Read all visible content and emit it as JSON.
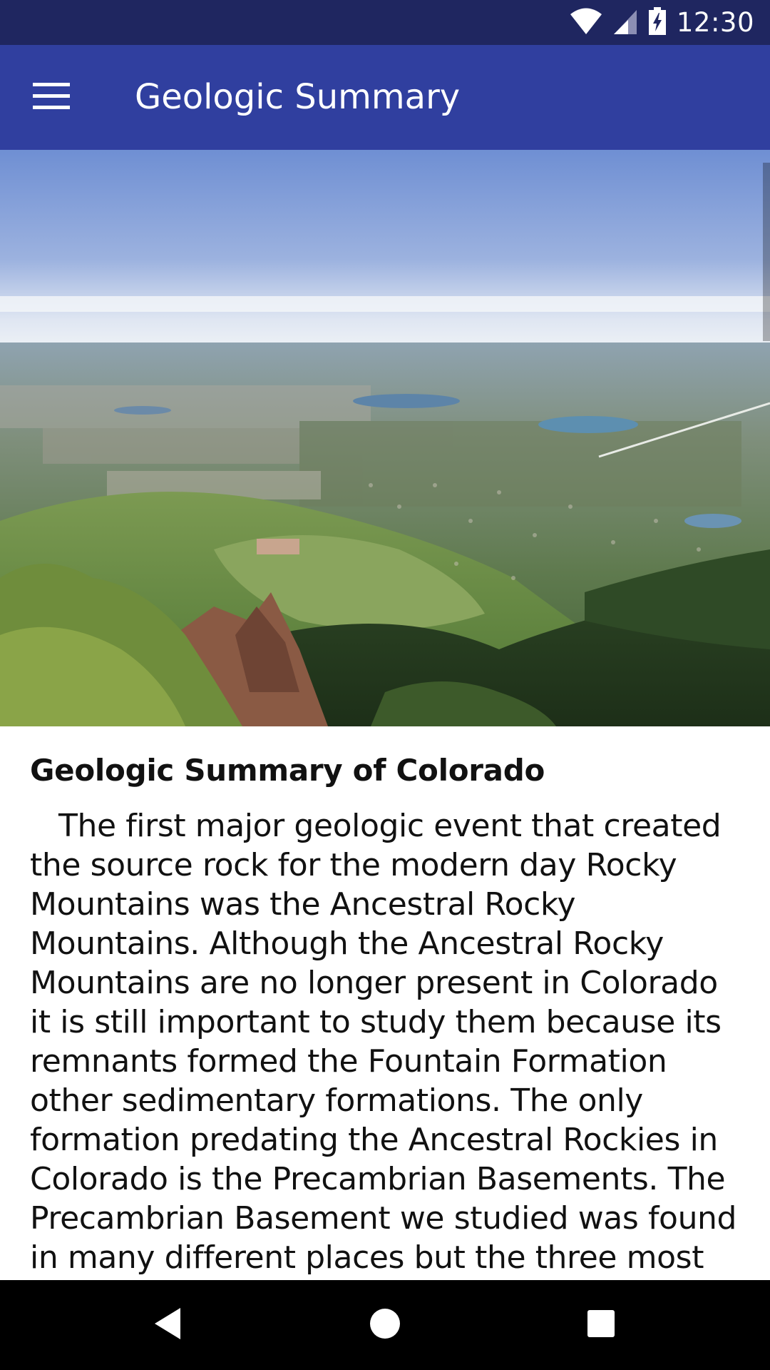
{
  "status_bar": {
    "time": "12:30",
    "icons": [
      "wifi-icon",
      "cell-signal-icon",
      "battery-charging-icon"
    ]
  },
  "app_bar": {
    "title": "Geologic Summary",
    "menu_icon": "hamburger-menu-icon",
    "color": "#303f9f"
  },
  "hero_image": {
    "subject": "aerial landscape photo"
  },
  "content": {
    "heading": "Geologic Summary of Colorado",
    "body": "The first major geologic event that created the source rock for the modern day Rocky Mountains was the Ancestral Rocky Mountains. Although the Ancestral Rocky Mountains are no longer present in Colorado it is still important to study them because its remnants formed the Fountain Formation other sedimentary formations. The only formation predating the Ancestral Rockies in Colorado is the Precambrian Basements. The Precambrian Basement we studied was found in many different places but the three most prominent"
  },
  "nav_bar": {
    "back_icon": "back-triangle-icon",
    "home_icon": "home-circle-icon",
    "recents_icon": "recents-square-icon"
  }
}
